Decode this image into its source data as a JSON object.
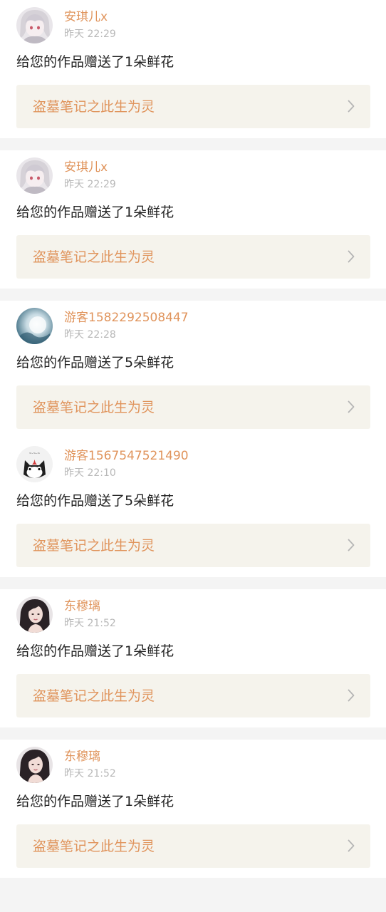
{
  "colors": {
    "accent": "#e0945c",
    "time": "#b8b8b8",
    "text": "#222222",
    "work_bg": "#f5f3ec",
    "page_bg": "#f4f4f4"
  },
  "notifications": [
    {
      "username": "安琪儿x",
      "time": "昨天 22:29",
      "message": "给您的作品赠送了1朵鲜花",
      "work_title": "盗墓笔记之此生为灵",
      "avatar": "anime-white-hair-avatar",
      "gap_after": true
    },
    {
      "username": "安琪儿x",
      "time": "昨天 22:29",
      "message": "给您的作品赠送了1朵鲜花",
      "work_title": "盗墓笔记之此生为灵",
      "avatar": "anime-white-hair-avatar",
      "gap_after": true
    },
    {
      "username": "游客1582292508447",
      "time": "昨天 22:28",
      "message": "给您的作品赠送了5朵鲜花",
      "work_title": "盗墓笔记之此生为灵",
      "avatar": "blue-moon-avatar",
      "gap_after": false
    },
    {
      "username": "游客1567547521490",
      "time": "昨天 22:10",
      "message": "给您的作品赠送了5朵鲜花",
      "work_title": "盗墓笔记之此生为灵",
      "avatar": "black-cat-avatar",
      "gap_after": true
    },
    {
      "username": "东穆璃",
      "time": "昨天 21:52",
      "message": "给您的作品赠送了1朵鲜花",
      "work_title": "盗墓笔记之此生为灵",
      "avatar": "dark-hair-girl-avatar",
      "gap_after": true
    },
    {
      "username": "东穆璃",
      "time": "昨天 21:52",
      "message": "给您的作品赠送了1朵鲜花",
      "work_title": "盗墓笔记之此生为灵",
      "avatar": "dark-hair-girl-avatar",
      "gap_after": false
    }
  ]
}
